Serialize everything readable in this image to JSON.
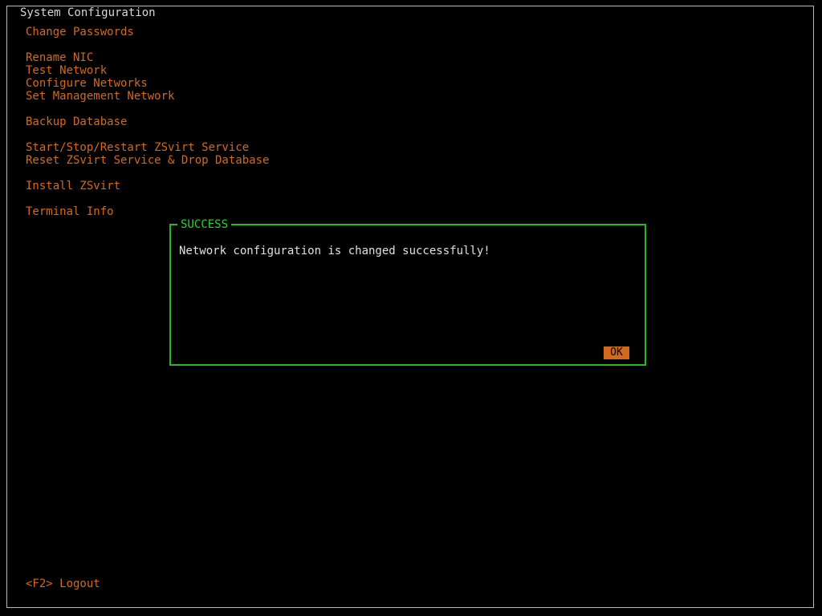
{
  "window": {
    "title": "System Configuration"
  },
  "menu": {
    "items": [
      {
        "label": "Change Passwords"
      },
      {
        "label": "Rename NIC"
      },
      {
        "label": "Test Network"
      },
      {
        "label": "Configure Networks"
      },
      {
        "label": "Set Management Network"
      },
      {
        "label": "Backup Database"
      },
      {
        "label": "Start/Stop/Restart ZSvirt Service"
      },
      {
        "label": "Reset ZSvirt Service & Drop Database"
      },
      {
        "label": "Install ZSvirt"
      },
      {
        "label": "Terminal Info"
      }
    ]
  },
  "footer": {
    "logout_label": "<F2> Logout"
  },
  "dialog": {
    "title": "SUCCESS",
    "message": "Network configuration is changed successfully!",
    "ok_label": "OK"
  },
  "colors": {
    "background": "#000000",
    "menu_text": "#d2691e",
    "dialog_border": "#2bb52b",
    "dialog_title": "#2bd42b",
    "ok_button_bg": "#d2691e"
  }
}
